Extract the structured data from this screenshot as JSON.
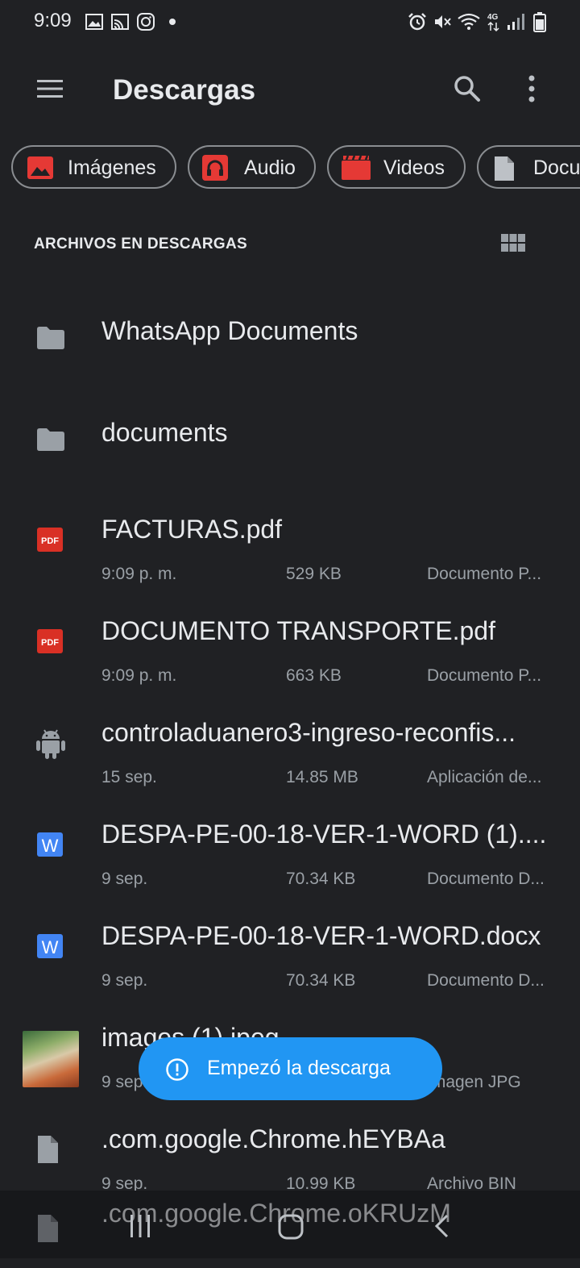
{
  "status_bar": {
    "time": "9:09"
  },
  "header": {
    "title": "Descargas"
  },
  "chips": [
    {
      "label": "Imágenes",
      "icon": "image-icon",
      "color": "#e53935"
    },
    {
      "label": "Audio",
      "icon": "headphones-icon",
      "color": "#e53935"
    },
    {
      "label": "Videos",
      "icon": "video-icon",
      "color": "#e53935"
    },
    {
      "label": "Docu",
      "icon": "document-icon",
      "color": "#bdc1c6"
    }
  ],
  "section": {
    "title": "ARCHIVOS EN DESCARGAS"
  },
  "items": [
    {
      "name": "WhatsApp Documents",
      "type": "folder"
    },
    {
      "name": "documents",
      "type": "folder"
    },
    {
      "name": "FACTURAS.pdf",
      "date": "9:09 p. m.",
      "size": "529 KB",
      "kind": "Documento P...",
      "icon_label": "PDF"
    },
    {
      "name": "DOCUMENTO TRANSPORTE.pdf",
      "date": "9:09 p. m.",
      "size": "663 KB",
      "kind": "Documento P...",
      "icon_label": "PDF"
    },
    {
      "name": "controladuanero3-ingreso-reconfis...",
      "date": "15 sep.",
      "size": "14.85 MB",
      "kind": "Aplicación de..."
    },
    {
      "name": "DESPA-PE-00-18-VER-1-WORD (1)....",
      "date": "9 sep.",
      "size": "70.34 KB",
      "kind": "Documento D...",
      "icon_label": "W"
    },
    {
      "name": "DESPA-PE-00-18-VER-1-WORD.docx",
      "date": "9 sep.",
      "size": "70.34 KB",
      "kind": "Documento D...",
      "icon_label": "W"
    },
    {
      "name": "images (1).jpeg",
      "date": "9 sep.",
      "size": "",
      "kind": "Imagen JPG"
    },
    {
      "name": ".com.google.Chrome.hEYBAa",
      "date": "9 sep.",
      "size": "10.99 KB",
      "kind": "Archivo BIN"
    },
    {
      "name": ".com.google.Chrome.oKRUzM"
    }
  ],
  "toast": {
    "message": "Empezó la descarga"
  },
  "colors": {
    "background": "#202124",
    "accent": "#2196f3",
    "pdf": "#d93025",
    "word": "#4285f4"
  }
}
